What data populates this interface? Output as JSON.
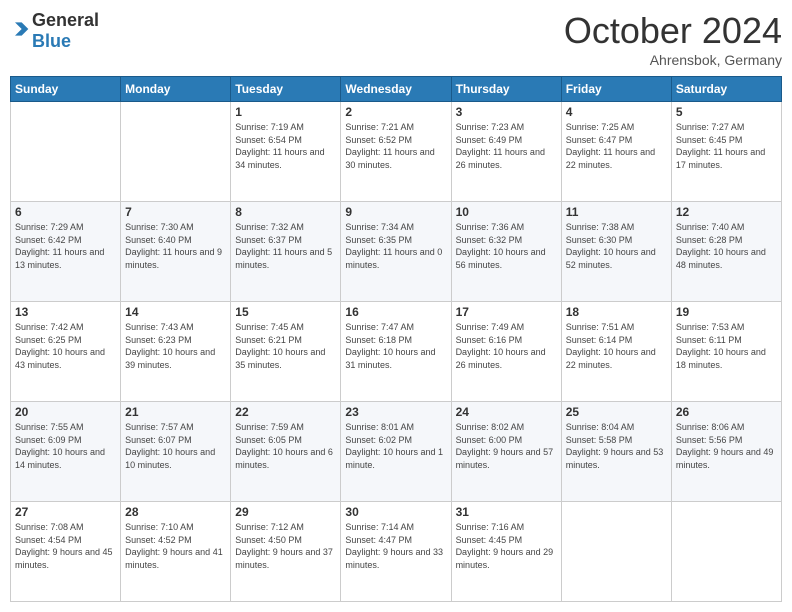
{
  "header": {
    "logo_general": "General",
    "logo_blue": "Blue",
    "month": "October 2024",
    "location": "Ahrensbok, Germany"
  },
  "days_of_week": [
    "Sunday",
    "Monday",
    "Tuesday",
    "Wednesday",
    "Thursday",
    "Friday",
    "Saturday"
  ],
  "weeks": [
    [
      {
        "day": "",
        "detail": ""
      },
      {
        "day": "",
        "detail": ""
      },
      {
        "day": "1",
        "detail": "Sunrise: 7:19 AM\nSunset: 6:54 PM\nDaylight: 11 hours\nand 34 minutes."
      },
      {
        "day": "2",
        "detail": "Sunrise: 7:21 AM\nSunset: 6:52 PM\nDaylight: 11 hours\nand 30 minutes."
      },
      {
        "day": "3",
        "detail": "Sunrise: 7:23 AM\nSunset: 6:49 PM\nDaylight: 11 hours\nand 26 minutes."
      },
      {
        "day": "4",
        "detail": "Sunrise: 7:25 AM\nSunset: 6:47 PM\nDaylight: 11 hours\nand 22 minutes."
      },
      {
        "day": "5",
        "detail": "Sunrise: 7:27 AM\nSunset: 6:45 PM\nDaylight: 11 hours\nand 17 minutes."
      }
    ],
    [
      {
        "day": "6",
        "detail": "Sunrise: 7:29 AM\nSunset: 6:42 PM\nDaylight: 11 hours\nand 13 minutes."
      },
      {
        "day": "7",
        "detail": "Sunrise: 7:30 AM\nSunset: 6:40 PM\nDaylight: 11 hours\nand 9 minutes."
      },
      {
        "day": "8",
        "detail": "Sunrise: 7:32 AM\nSunset: 6:37 PM\nDaylight: 11 hours\nand 5 minutes."
      },
      {
        "day": "9",
        "detail": "Sunrise: 7:34 AM\nSunset: 6:35 PM\nDaylight: 11 hours\nand 0 minutes."
      },
      {
        "day": "10",
        "detail": "Sunrise: 7:36 AM\nSunset: 6:32 PM\nDaylight: 10 hours\nand 56 minutes."
      },
      {
        "day": "11",
        "detail": "Sunrise: 7:38 AM\nSunset: 6:30 PM\nDaylight: 10 hours\nand 52 minutes."
      },
      {
        "day": "12",
        "detail": "Sunrise: 7:40 AM\nSunset: 6:28 PM\nDaylight: 10 hours\nand 48 minutes."
      }
    ],
    [
      {
        "day": "13",
        "detail": "Sunrise: 7:42 AM\nSunset: 6:25 PM\nDaylight: 10 hours\nand 43 minutes."
      },
      {
        "day": "14",
        "detail": "Sunrise: 7:43 AM\nSunset: 6:23 PM\nDaylight: 10 hours\nand 39 minutes."
      },
      {
        "day": "15",
        "detail": "Sunrise: 7:45 AM\nSunset: 6:21 PM\nDaylight: 10 hours\nand 35 minutes."
      },
      {
        "day": "16",
        "detail": "Sunrise: 7:47 AM\nSunset: 6:18 PM\nDaylight: 10 hours\nand 31 minutes."
      },
      {
        "day": "17",
        "detail": "Sunrise: 7:49 AM\nSunset: 6:16 PM\nDaylight: 10 hours\nand 26 minutes."
      },
      {
        "day": "18",
        "detail": "Sunrise: 7:51 AM\nSunset: 6:14 PM\nDaylight: 10 hours\nand 22 minutes."
      },
      {
        "day": "19",
        "detail": "Sunrise: 7:53 AM\nSunset: 6:11 PM\nDaylight: 10 hours\nand 18 minutes."
      }
    ],
    [
      {
        "day": "20",
        "detail": "Sunrise: 7:55 AM\nSunset: 6:09 PM\nDaylight: 10 hours\nand 14 minutes."
      },
      {
        "day": "21",
        "detail": "Sunrise: 7:57 AM\nSunset: 6:07 PM\nDaylight: 10 hours\nand 10 minutes."
      },
      {
        "day": "22",
        "detail": "Sunrise: 7:59 AM\nSunset: 6:05 PM\nDaylight: 10 hours\nand 6 minutes."
      },
      {
        "day": "23",
        "detail": "Sunrise: 8:01 AM\nSunset: 6:02 PM\nDaylight: 10 hours\nand 1 minute."
      },
      {
        "day": "24",
        "detail": "Sunrise: 8:02 AM\nSunset: 6:00 PM\nDaylight: 9 hours\nand 57 minutes."
      },
      {
        "day": "25",
        "detail": "Sunrise: 8:04 AM\nSunset: 5:58 PM\nDaylight: 9 hours\nand 53 minutes."
      },
      {
        "day": "26",
        "detail": "Sunrise: 8:06 AM\nSunset: 5:56 PM\nDaylight: 9 hours\nand 49 minutes."
      }
    ],
    [
      {
        "day": "27",
        "detail": "Sunrise: 7:08 AM\nSunset: 4:54 PM\nDaylight: 9 hours\nand 45 minutes."
      },
      {
        "day": "28",
        "detail": "Sunrise: 7:10 AM\nSunset: 4:52 PM\nDaylight: 9 hours\nand 41 minutes."
      },
      {
        "day": "29",
        "detail": "Sunrise: 7:12 AM\nSunset: 4:50 PM\nDaylight: 9 hours\nand 37 minutes."
      },
      {
        "day": "30",
        "detail": "Sunrise: 7:14 AM\nSunset: 4:47 PM\nDaylight: 9 hours\nand 33 minutes."
      },
      {
        "day": "31",
        "detail": "Sunrise: 7:16 AM\nSunset: 4:45 PM\nDaylight: 9 hours\nand 29 minutes."
      },
      {
        "day": "",
        "detail": ""
      },
      {
        "day": "",
        "detail": ""
      }
    ]
  ]
}
